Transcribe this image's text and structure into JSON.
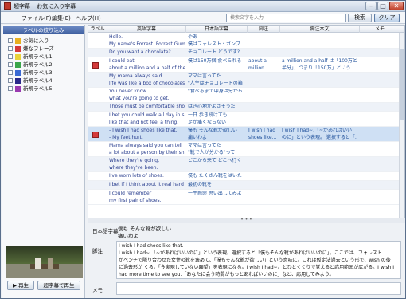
{
  "window": {
    "app_name": "超字幕",
    "doc_title": "お気に入り字幕"
  },
  "menu": [
    "ファイル(F)",
    "編集(E)",
    "ヘルプ(H)"
  ],
  "search": {
    "placeholder": "検索文字を入力",
    "search_label": "検索",
    "clear_label": "クリア"
  },
  "sidebar": {
    "filter_title": "ラベルの絞り込み",
    "labels": [
      {
        "name": "お気に入り",
        "color": "#e8b020"
      },
      {
        "name": "嫌なフレーズ",
        "color": "#d43a3a"
      },
      {
        "name": "新規ラベル1",
        "color": "#e9d33a"
      },
      {
        "name": "新規ラベル2",
        "color": "#3aa64a"
      },
      {
        "name": "新規ラベル3",
        "color": "#3a6ad4"
      },
      {
        "name": "新規ラベル4",
        "color": "#2a2a8a"
      },
      {
        "name": "新規ラベル5",
        "color": "#9a3ab0"
      }
    ],
    "play_label": "▶ 再生",
    "play_subs_label": "超字幕で再生"
  },
  "table": {
    "columns": [
      "ラベル",
      "英語字幕",
      "日本語字幕",
      "脚注",
      "脚注本文",
      "メモ"
    ],
    "rows": [
      {
        "label_color": "",
        "en": "Hello.\nMy name's Forrest. Forrest Gum",
        "ja": "やあ\n僕はフォレスト・ガンプ",
        "note": "",
        "note_text": ""
      },
      {
        "label_color": "",
        "en": "Do you want a chocolate?",
        "ja": "チョコレート どうです?",
        "note": "",
        "note_text": ""
      },
      {
        "label_color": "#d43a3a",
        "en": "I could eat\nabout a million and a half of the",
        "ja": "僕は150万個 食べられる",
        "note": "about a\nmillion…",
        "note_text": "a million and a half は「100万と\n半分」，つまり「150万」という…"
      },
      {
        "label_color": "",
        "en": "My mama always said\nlife was like a box of chocolates.",
        "ja": "ママは言ってた\n\"人生はチョコレートの箱",
        "note": "",
        "note_text": ""
      },
      {
        "label_color": "",
        "en": "You never know\nwhat you're going to get.",
        "ja": "\"食べるまで中身は分から",
        "note": "",
        "note_text": ""
      },
      {
        "label_color": "",
        "en": "Those must be comfortable shoe",
        "ja": "はき心地がよさそうだ",
        "note": "",
        "note_text": ""
      },
      {
        "label_color": "",
        "en": "I bet you could walk all day in sl\nlike that and not feel a thing.",
        "ja": "一日 歩き続けても\n足が痛くならない",
        "note": "",
        "note_text": ""
      },
      {
        "label_color": "#d43a3a",
        "en": "- I wish I had shoes like that.\n- My feet hurt.",
        "ja": "僕も そんな靴が欲しい\n痛いわよ",
        "note": "I wish I had\nshoes like…",
        "note_text": "I wish I had~.「~があればいい\nのに」という表現。 選択すると「…"
      },
      {
        "label_color": "",
        "en": "Mama always said you can tell\na lot about a person by their sh",
        "ja": "ママは言ってた\n\"靴で人が分かる\"って",
        "note": "",
        "note_text": ""
      },
      {
        "label_color": "",
        "en": "Where they're going,\nwhere they've been.",
        "ja": "どこから来て どこへ行く",
        "note": "",
        "note_text": ""
      },
      {
        "label_color": "",
        "en": "I've worn lots of shoes.",
        "ja": "僕も たくさん靴をはいた",
        "note": "",
        "note_text": ""
      },
      {
        "label_color": "",
        "en": "I bet if I think about it real hard",
        "ja": "最初の靴を",
        "note": "",
        "note_text": ""
      },
      {
        "label_color": "",
        "en": "I could remember\nmy first pair of shoes.",
        "ja": "一生懸命 思い出してみよ",
        "note": "",
        "note_text": ""
      }
    ]
  },
  "detail": {
    "ja_label": "日本語字幕",
    "ja_text": "僕も そんな靴が欲しい\n痛いわよ",
    "note_label": "脚注",
    "note_text": "I wish I had shoes like that.\nI wish I had~.「~があればいいのに」という表現。選択すると「僕もそんな靴があればいいのに」。ここでは、フォレスト\nがベンチで隣り合わせた女性の靴を褒めて、「僕もそんな靴が欲しい」という意味に。これは仮定法過去という形で、wish の後\nに過去形が くる。「今実現していない願望」を表現になる。I wish I had~。とひとくくりで覚えると応用範囲が広がる。I wish I\nhad more time to see you.「あなたに会う時間がもっとあればいいのに」など、応用してみよう。",
    "memo_label": "メモ"
  }
}
